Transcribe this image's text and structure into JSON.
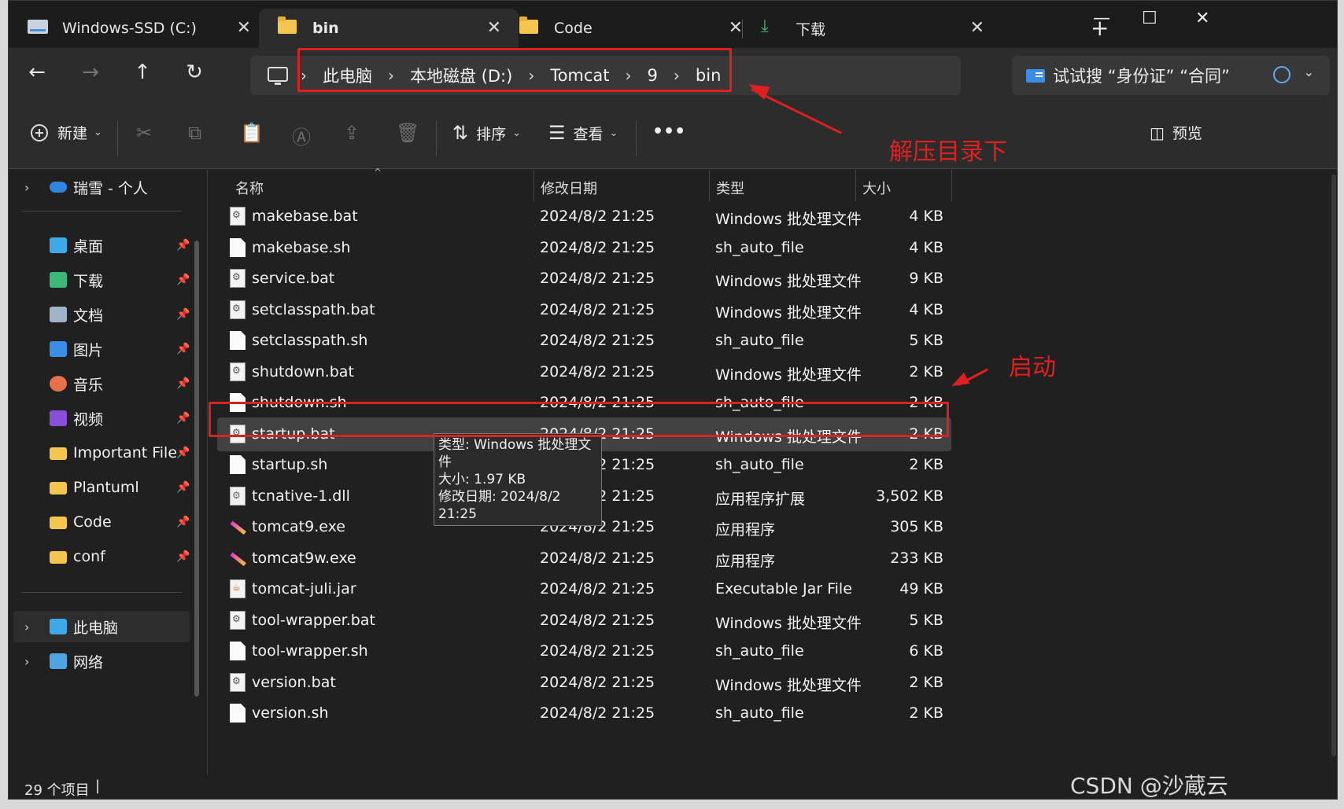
{
  "tabs": [
    {
      "label": "Windows-SSD (C:)",
      "icon": "drive-icon"
    },
    {
      "label": "bin",
      "icon": "folder-icon",
      "active": true
    },
    {
      "label": "Code",
      "icon": "folder-icon"
    },
    {
      "label": "下载",
      "icon": "download-icon"
    }
  ],
  "window_controls": {
    "new_tab": "+",
    "minimize": "—",
    "maximize": "☐",
    "close": "✕"
  },
  "breadcrumb": [
    "此电脑",
    "本地磁盘 (D:)",
    "Tomcat",
    "9",
    "bin"
  ],
  "search": {
    "placeholder": "试试搜 “身份证” “合同”"
  },
  "toolbar": {
    "new_label": "新建",
    "sort_label": "排序",
    "view_label": "查看",
    "more_label": "•••",
    "preview_label": "预览"
  },
  "sidebar": {
    "cloud": "瑞雪 - 个人",
    "quick_access": [
      {
        "label": "桌面",
        "icon": "desktop-icon",
        "color": "#3fa8e8"
      },
      {
        "label": "下载",
        "icon": "download-icon",
        "color": "#3cb878"
      },
      {
        "label": "文档",
        "icon": "document-icon",
        "color": "#9fb3c8"
      },
      {
        "label": "图片",
        "icon": "pictures-icon",
        "color": "#3a8ee6"
      },
      {
        "label": "音乐",
        "icon": "music-icon",
        "color": "#e8704a"
      },
      {
        "label": "视频",
        "icon": "video-icon",
        "color": "#8a4fd8"
      },
      {
        "label": "Important File",
        "icon": "folder-icon",
        "color": "#f4c64f"
      },
      {
        "label": "Plantuml",
        "icon": "folder-icon",
        "color": "#f4c64f"
      },
      {
        "label": "Code",
        "icon": "folder-icon",
        "color": "#f4c64f"
      },
      {
        "label": "conf",
        "icon": "folder-icon",
        "color": "#f4c64f"
      }
    ],
    "this_pc": "此电脑",
    "network": "网络"
  },
  "columns": {
    "name": "名称",
    "date": "修改日期",
    "type": "类型",
    "size": "大小"
  },
  "files": [
    {
      "name": "makebase.bat",
      "date": "2024/8/2 21:25",
      "type": "Windows 批处理文件",
      "size": "4 KB",
      "kind": "bat"
    },
    {
      "name": "makebase.sh",
      "date": "2024/8/2 21:25",
      "type": "sh_auto_file",
      "size": "4 KB",
      "kind": "sh"
    },
    {
      "name": "service.bat",
      "date": "2024/8/2 21:25",
      "type": "Windows 批处理文件",
      "size": "9 KB",
      "kind": "bat"
    },
    {
      "name": "setclasspath.bat",
      "date": "2024/8/2 21:25",
      "type": "Windows 批处理文件",
      "size": "4 KB",
      "kind": "bat"
    },
    {
      "name": "setclasspath.sh",
      "date": "2024/8/2 21:25",
      "type": "sh_auto_file",
      "size": "5 KB",
      "kind": "sh"
    },
    {
      "name": "shutdown.bat",
      "date": "2024/8/2 21:25",
      "type": "Windows 批处理文件",
      "size": "2 KB",
      "kind": "bat"
    },
    {
      "name": "shutdown.sh",
      "date": "2024/8/2 21:25",
      "type": "sh_auto_file",
      "size": "2 KB",
      "kind": "sh"
    },
    {
      "name": "startup.bat",
      "date": "2024/8/2 21:25",
      "type": "Windows 批处理文件",
      "size": "2 KB",
      "kind": "bat",
      "selected": true
    },
    {
      "name": "startup.sh",
      "date": "2024/8/2 21:25",
      "type": "sh_auto_file",
      "size": "2 KB",
      "kind": "sh"
    },
    {
      "name": "tcnative-1.dll",
      "date": "2024/8/2 21:25",
      "type": "应用程序扩展",
      "size": "3,502 KB",
      "kind": "dll"
    },
    {
      "name": "tomcat9.exe",
      "date": "2024/8/2 21:25",
      "type": "应用程序",
      "size": "305 KB",
      "kind": "exe"
    },
    {
      "name": "tomcat9w.exe",
      "date": "2024/8/2 21:25",
      "type": "应用程序",
      "size": "233 KB",
      "kind": "exe"
    },
    {
      "name": "tomcat-juli.jar",
      "date": "2024/8/2 21:25",
      "type": "Executable Jar File",
      "size": "49 KB",
      "kind": "jar"
    },
    {
      "name": "tool-wrapper.bat",
      "date": "2024/8/2 21:25",
      "type": "Windows 批处理文件",
      "size": "5 KB",
      "kind": "bat"
    },
    {
      "name": "tool-wrapper.sh",
      "date": "2024/8/2 21:25",
      "type": "sh_auto_file",
      "size": "6 KB",
      "kind": "sh"
    },
    {
      "name": "version.bat",
      "date": "2024/8/2 21:25",
      "type": "Windows 批处理文件",
      "size": "2 KB",
      "kind": "bat"
    },
    {
      "name": "version.sh",
      "date": "2024/8/2 21:25",
      "type": "sh_auto_file",
      "size": "2 KB",
      "kind": "sh"
    }
  ],
  "tooltip": {
    "type_line": "类型: Windows 批处理文件",
    "size_line": "大小: 1.97 KB",
    "date_line": "修改日期: 2024/8/2 21:25"
  },
  "status": {
    "count": "29 个项目",
    "caret": "|"
  },
  "annotations": {
    "extract_dir": "解压目录下",
    "startup": "启动",
    "color": "#e02020"
  },
  "watermark": "CSDN @沙蔵云"
}
